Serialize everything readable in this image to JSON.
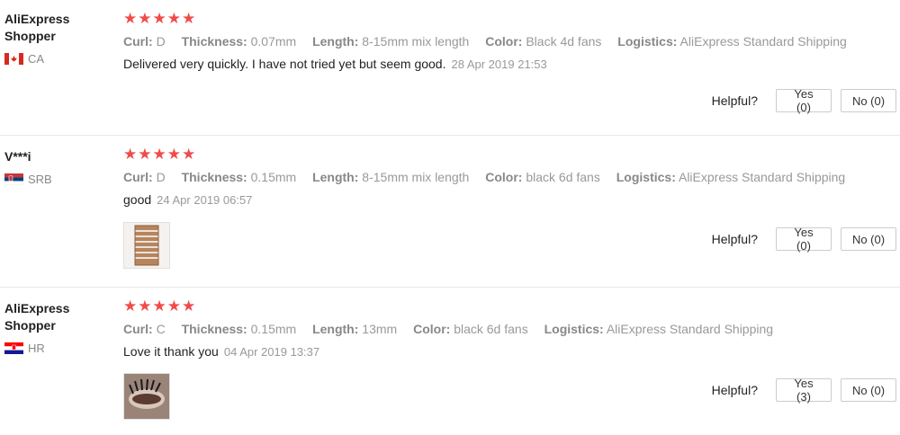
{
  "labels": {
    "curl": "Curl:",
    "thickness": "Thickness:",
    "length": "Length:",
    "color": "Color:",
    "logistics": "Logistics:",
    "helpful": "Helpful?"
  },
  "colors": {
    "star": "#f04b4b",
    "meta": "#999999"
  },
  "reviews": [
    {
      "name": "AliExpress Shopper",
      "country": "CA",
      "stars": "★★★★★",
      "rating": 5,
      "curl": "D",
      "thickness": "0.07mm",
      "length": "8-15mm mix length",
      "color": "Black 4d fans",
      "logistics": "AliExpress Standard Shipping",
      "text": "Delivered very quickly. I have not tried yet but seem good.",
      "date": "28 Apr 2019 21:53",
      "yes": "Yes (0)",
      "no": "No (0)"
    },
    {
      "name": "V***i",
      "country": "SRB",
      "stars": "★★★★★",
      "rating": 5,
      "curl": "D",
      "thickness": "0.15mm",
      "length": "8-15mm mix length",
      "color": "black 6d fans",
      "logistics": "AliExpress Standard Shipping",
      "text": "good",
      "date": "24 Apr 2019 06:57",
      "yes": "Yes (0)",
      "no": "No (0)"
    },
    {
      "name": "AliExpress Shopper",
      "country": "HR",
      "stars": "★★★★★",
      "rating": 5,
      "curl": "C",
      "thickness": "0.15mm",
      "length": "13mm",
      "color": "black 6d fans",
      "logistics": "AliExpress Standard Shipping",
      "text": "Love it thank you",
      "date": "04 Apr 2019 13:37",
      "yes": "Yes (3)",
      "no": "No (0)"
    }
  ]
}
